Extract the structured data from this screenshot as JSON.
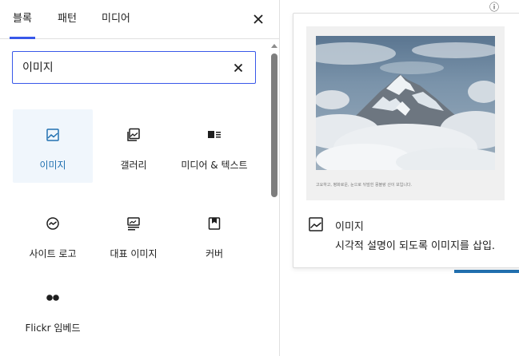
{
  "tabs": [
    {
      "label": "블록",
      "active": true
    },
    {
      "label": "패턴",
      "active": false
    },
    {
      "label": "미디어",
      "active": false
    }
  ],
  "search": {
    "value": "이미지",
    "placeholder": ""
  },
  "blocks": [
    {
      "label": "이미지",
      "icon": "image-icon",
      "selected": true
    },
    {
      "label": "갤러리",
      "icon": "gallery-icon"
    },
    {
      "label": "미디어 & 텍스트",
      "icon": "media-text-icon"
    },
    {
      "label": "사이트 로고",
      "icon": "site-logo-icon"
    },
    {
      "label": "대표 이미지",
      "icon": "featured-image-icon"
    },
    {
      "label": "커버",
      "icon": "cover-icon"
    },
    {
      "label": "Flickr 임베드",
      "icon": "flickr-icon"
    }
  ],
  "preview": {
    "caption": "고요하고, 평화로운, 눈으로 뒤덮힌 몽블랑 산이 보입니다.",
    "title": "이미지",
    "description": "시각적 설명이 되도록 이미지를 삽입."
  },
  "colors": {
    "accent": "#3858e9",
    "selected_text": "#2271b1",
    "selected_bg": "#f0f6fc"
  }
}
